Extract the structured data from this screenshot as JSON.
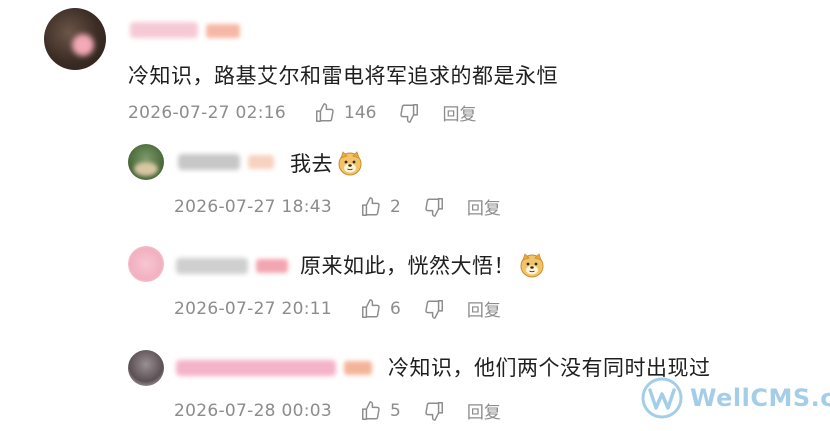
{
  "comments": [
    {
      "text": "冷知识，路基艾尔和雷电将军追求的都是永恒",
      "date": "2026-07-27 02:16",
      "likes": "146",
      "reply_label": "回复"
    },
    {
      "text": "我去",
      "date": "2026-07-27 18:43",
      "likes": "2",
      "reply_label": "回复"
    },
    {
      "text": "原来如此，恍然大悟！",
      "date": "2026-07-27 20:11",
      "likes": "6",
      "reply_label": "回复"
    },
    {
      "text": "冷知识，他们两个没有同时出现过",
      "date": "2026-07-28 00:03",
      "likes": "5",
      "reply_label": "回复"
    }
  ],
  "watermark": {
    "text": "WellCMS.cn"
  },
  "colors": {
    "meta": "#8c8c8c",
    "text": "#1f1f1f",
    "watermark": "#5aa7d6"
  }
}
